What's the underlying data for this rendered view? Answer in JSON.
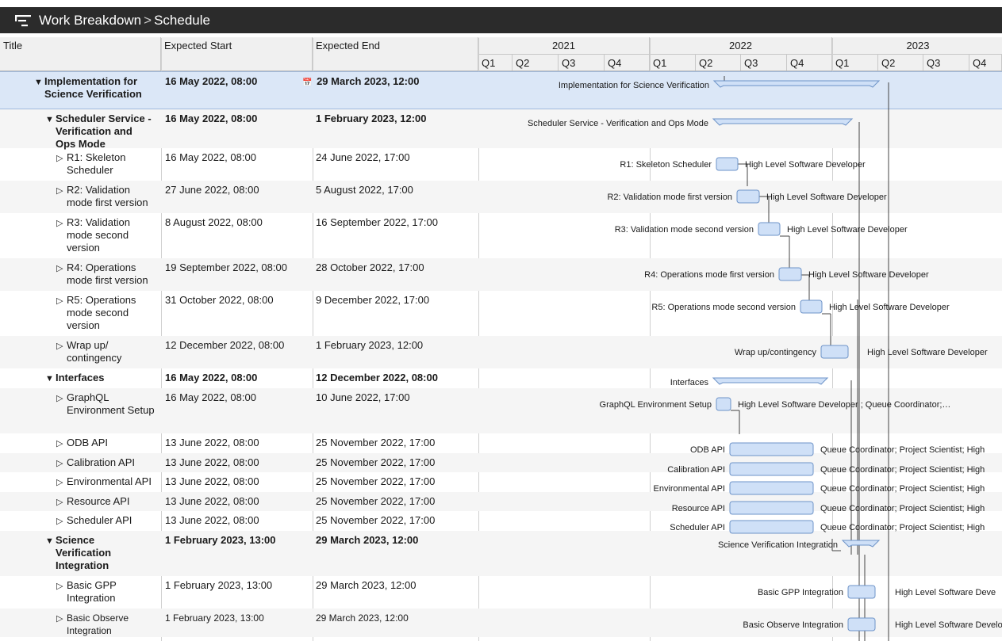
{
  "titlebar": {
    "icon": "work-breakdown-icon",
    "crumb1": "Work Breakdown",
    "separator": ">",
    "crumb2": "Schedule"
  },
  "columns": {
    "title": "Title",
    "start": "Expected Start",
    "end": "Expected End"
  },
  "timeline": {
    "years": [
      "2021",
      "2022",
      "2023"
    ],
    "quarters": [
      "Q1",
      "Q2",
      "Q3",
      "Q4",
      "Q1",
      "Q2",
      "Q3",
      "Q4",
      "Q1",
      "Q2",
      "Q3",
      "Q4"
    ]
  },
  "rows": [
    {
      "title": "Implementation for Science Verification",
      "start": "16 May 2022, 08:00",
      "end": "29 March 2023, 12:00",
      "level": 0,
      "bold": true,
      "expanded": true,
      "selected": true,
      "calendar_icon": true,
      "gantt_label": "Implementation for Science Verification",
      "assignees": ""
    },
    {
      "title": "Scheduler Service - Verification and Ops Mode",
      "start": "16 May 2022, 08:00",
      "end": "1 February 2023, 12:00",
      "level": 1,
      "bold": true,
      "expanded": true,
      "gantt_label": "Scheduler Service - Verification and Ops Mode",
      "assignees": ""
    },
    {
      "title": "R1: Skeleton Scheduler",
      "start": "16 May 2022, 08:00",
      "end": "24 June 2022, 17:00",
      "level": 2,
      "gantt_label": "R1: Skeleton Scheduler",
      "assignees": "High Level Software Developer"
    },
    {
      "title": "R2: Validation mode first version",
      "start": "27 June 2022, 08:00",
      "end": "5 August 2022, 17:00",
      "level": 2,
      "gantt_label": "R2: Validation mode first version",
      "assignees": "High Level Software Developer"
    },
    {
      "title": "R3: Validation mode second version",
      "start": "8 August 2022, 08:00",
      "end": "16 September 2022, 17:00",
      "level": 2,
      "gantt_label": "R3: Validation mode second version",
      "assignees": "High Level Software Developer"
    },
    {
      "title": "R4: Operations mode first version",
      "start": "19 September 2022, 08:00",
      "end": "28 October 2022, 17:00",
      "level": 2,
      "gantt_label": "R4: Operations mode first version",
      "assignees": "High Level Software Developer"
    },
    {
      "title": "R5: Operations mode second version",
      "start": "31 October 2022, 08:00",
      "end": "9 December 2022, 17:00",
      "level": 2,
      "gantt_label": "R5: Operations mode second version",
      "assignees": "High Level Software Developer"
    },
    {
      "title": "Wrap up/ contingency",
      "start": "12 December 2022, 08:00",
      "end": "1 February 2023, 12:00",
      "level": 2,
      "gantt_label": "Wrap up/contingency",
      "assignees": "High Level Software Developer"
    },
    {
      "title": "Interfaces",
      "start": "16 May 2022, 08:00",
      "end": "12 December 2022, 08:00",
      "level": 1,
      "bold": true,
      "expanded": true,
      "gantt_label": "Interfaces",
      "assignees": ""
    },
    {
      "title": "GraphQL Environment Setup",
      "start": "16 May 2022, 08:00",
      "end": "10 June 2022, 17:00",
      "level": 2,
      "gantt_label": "GraphQL Environment Setup",
      "assignees": "High Level Software Developer ; Queue Coordinator;…"
    },
    {
      "title": "ODB API",
      "start": "13 June 2022, 08:00",
      "end": "25 November 2022, 17:00",
      "level": 2,
      "gantt_label": "ODB API",
      "assignees": "Queue Coordinator; Project Scientist; High"
    },
    {
      "title": "Calibration API",
      "start": "13 June 2022, 08:00",
      "end": "25 November 2022, 17:00",
      "level": 2,
      "gantt_label": "Calibration API",
      "assignees": "Queue Coordinator; Project Scientist; High"
    },
    {
      "title": "Environmental API",
      "start": "13 June 2022, 08:00",
      "end": "25 November 2022, 17:00",
      "level": 2,
      "gantt_label": "Environmental API",
      "assignees": "Queue Coordinator; Project Scientist; High"
    },
    {
      "title": "Resource API",
      "start": "13 June 2022, 08:00",
      "end": "25 November 2022, 17:00",
      "level": 2,
      "gantt_label": "Resource API",
      "assignees": "Queue Coordinator; Project Scientist; High"
    },
    {
      "title": "Scheduler API",
      "start": "13 June 2022, 08:00",
      "end": "25 November 2022, 17:00",
      "level": 2,
      "gantt_label": "Scheduler API",
      "assignees": "Queue Coordinator; Project Scientist; High"
    },
    {
      "title": "Science Verification Integration",
      "start": "1 February 2023, 13:00",
      "end": "29 March 2023, 12:00",
      "level": 1,
      "bold": true,
      "expanded": true,
      "gantt_label": "Science Verification Integration",
      "assignees": ""
    },
    {
      "title": "Basic GPP Integration",
      "start": "1 February 2023, 13:00",
      "end": "29 March 2023, 12:00",
      "level": 2,
      "gantt_label": "Basic GPP Integration",
      "assignees": "High Level Software Deve"
    },
    {
      "title": "Basic Observe Integration",
      "start": "1 February 2023, 13:00",
      "end": "29 March 2023, 12:00",
      "level": 2,
      "small": true,
      "gantt_label": "Basic Observe Integration",
      "assignees": "High Level Software Develo"
    }
  ],
  "colors": {
    "bar_fill": "#cfe0f7",
    "bar_stroke": "#6d93c8",
    "selection": "#dbe7f7",
    "titlebar": "#2b2b2b"
  }
}
